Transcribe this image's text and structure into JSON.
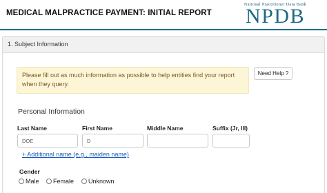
{
  "header": {
    "title": "MEDICAL MALPRACTICE PAYMENT: INITIAL REPORT",
    "logo_top": "National Practitioner Data Bank",
    "logo_main": "NPDB"
  },
  "panel": {
    "title": "1. Subject Information"
  },
  "alert": {
    "text": "Please fill out as much information as possible to help entities find your report when they query."
  },
  "help_button": {
    "label": "Need Help ?"
  },
  "personal_info": {
    "title": "Personal Information",
    "fields": [
      {
        "label": "Last Name",
        "value": "DOE"
      },
      {
        "label": "First Name",
        "value": "D"
      },
      {
        "label": "Middle Name",
        "value": ""
      },
      {
        "label": "Suffix (Jr, III)",
        "value": ""
      }
    ],
    "additional_name_link": "+ Additional name (e.g., maiden name)"
  },
  "gender": {
    "label": "Gender",
    "options": [
      "Male",
      "Female",
      "Unknown"
    ]
  },
  "colors": {
    "brand": "#1e6f8a",
    "alert_bg": "#fcf5d6",
    "alert_text": "#7a5a25",
    "link": "#1a5cb5"
  }
}
